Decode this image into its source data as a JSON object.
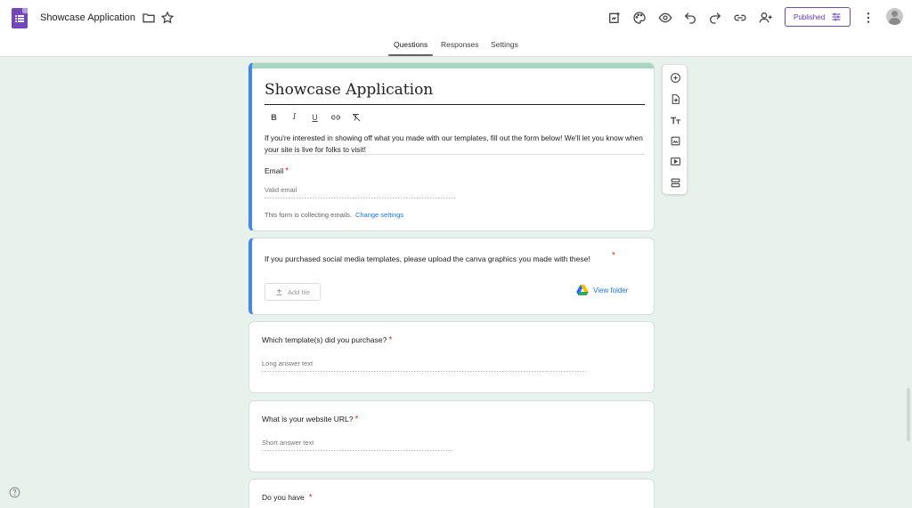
{
  "header": {
    "title": "Showcase Application",
    "published_label": "Published"
  },
  "tabs": [
    {
      "label": "Questions"
    },
    {
      "label": "Responses"
    },
    {
      "label": "Settings"
    }
  ],
  "form": {
    "title": "Showcase Application",
    "description": "If you're interested in showing off what you made with our templates, fill out the form below! We'll let you know when your site is live for folks to visit!",
    "email_label": "Email",
    "email_placeholder": "Valid email",
    "collecting_note": "This form is collecting emails.",
    "change_settings": "Change settings"
  },
  "questions": [
    {
      "label": "If you purchased social media templates, please upload the canva graphics you made with these!",
      "add_file": "Add file",
      "view_folder": "View folder"
    },
    {
      "label": "Which template(s) did you purchase?",
      "answer": "Long answer text"
    },
    {
      "label": "What is your website URL?",
      "answer": "Short answer text"
    },
    {
      "label": "Do you have"
    }
  ],
  "required_marker": "*",
  "colors": {
    "accent": "#7248b9",
    "selected": "#4285f4",
    "theme": "#a8d8c0",
    "background": "#e7f2ec"
  }
}
